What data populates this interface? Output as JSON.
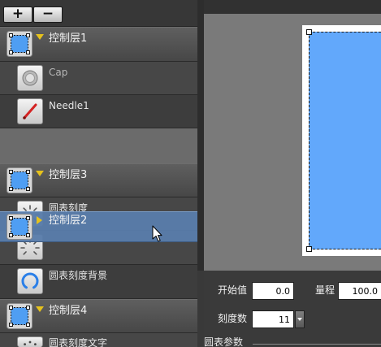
{
  "toolbar": {
    "add_label": "+",
    "remove_label": "−"
  },
  "layer_panel": {
    "groups": [
      {
        "name": "控制层1",
        "expanded": true,
        "icon": "layer-group-icon",
        "items": [
          {
            "name": "Cap",
            "icon": "knob-icon"
          },
          {
            "name": "Needle1",
            "icon": "needle-icon"
          }
        ]
      },
      {
        "name": "控制层3",
        "expanded": true,
        "icon": "layer-group-icon",
        "items": [
          {
            "name": "圆表刻度",
            "icon": "gauge-scale-icon"
          },
          {
            "icon": "gauge-scale-icon"
          },
          {
            "name": "圆表刻度背景",
            "icon": "gauge-ring-icon"
          }
        ]
      },
      {
        "name": "控制层4",
        "expanded": true,
        "icon": "layer-group-icon",
        "items": [
          {
            "name": "圆表刻度文字",
            "icon": "gauge-text-icon"
          }
        ]
      }
    ],
    "dragged_group": {
      "name": "控制层2",
      "expanded": false,
      "icon": "layer-group-icon"
    }
  },
  "properties": {
    "start_value": {
      "label": "开始值",
      "value": "0.0"
    },
    "range": {
      "label": "量程",
      "value": "100.0"
    },
    "tick_count": {
      "label": "刻度数",
      "value": "11"
    },
    "section_title": "圆表参数"
  },
  "cursor": {
    "icon": "arrow-cursor-icon"
  },
  "colors": {
    "selection_fill": "#62a8fb",
    "drag_highlight": "#587caa",
    "expander": "#e6c21c",
    "panel_bg": "#454545",
    "canvas_bg": "#7a7a7a"
  }
}
